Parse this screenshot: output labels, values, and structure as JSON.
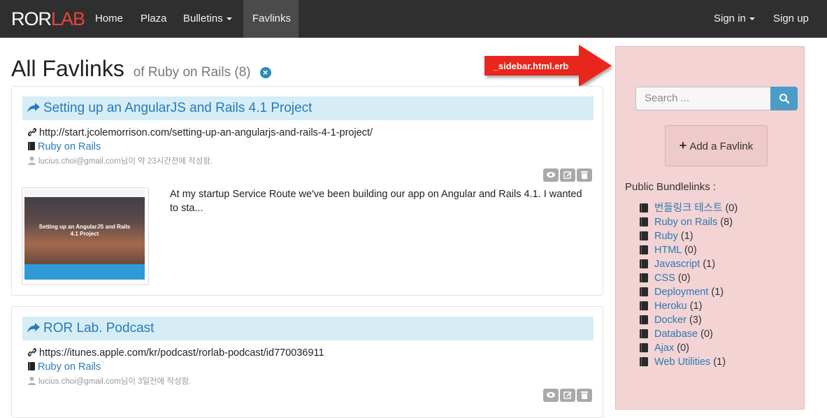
{
  "navbar": {
    "brand_a": "ROR",
    "brand_b": "LAB",
    "items": [
      {
        "label": "Home"
      },
      {
        "label": "Plaza"
      },
      {
        "label": "Bulletins"
      },
      {
        "label": "Favlinks"
      }
    ],
    "active": "Favlinks",
    "right": [
      {
        "label": "Sign in"
      },
      {
        "label": "Sign up"
      }
    ]
  },
  "page": {
    "title": "All Favlinks",
    "subtitle": "of Ruby on Rails (8)"
  },
  "annotation": {
    "label": "_sidebar.html.erb",
    "color": "#e8261b"
  },
  "cards": [
    {
      "title": "Setting up an AngularJS and Rails 4.1 Project",
      "url": "http://start.jcolemorrison.com/setting-up-an-angularjs-and-rails-4-1-project/",
      "bundle": "Ruby on Rails",
      "author": "lucius.choi@gmail.com님이 약 23시간전에 작성함.",
      "thumb_caption": "Setting up an AngularJS and Rails 4.1 Project",
      "summary": "At my startup Service Route we've been building our app on Angular and Rails 4.1. I wanted to sta..."
    },
    {
      "title": "ROR Lab. Podcast",
      "url": "https://itunes.apple.com/kr/podcast/rorlab-podcast/id770036911",
      "bundle": "Ruby on Rails",
      "author": "lucius.choi@gmail.com님이 3일전에 작성함."
    }
  ],
  "sidebar": {
    "search_placeholder": "Search ...",
    "add_label": "Add a Favlink",
    "bundlelinks_title": "Public Bundlelinks :",
    "bundlelinks": [
      {
        "name": "번들링크 테스트",
        "count": "(0)"
      },
      {
        "name": "Ruby on Rails",
        "count": "(8)"
      },
      {
        "name": "Ruby",
        "count": "(1)"
      },
      {
        "name": "HTML",
        "count": "(0)"
      },
      {
        "name": "Javascript",
        "count": "(1)"
      },
      {
        "name": "CSS",
        "count": "(0)"
      },
      {
        "name": "Deployment",
        "count": "(1)"
      },
      {
        "name": "Heroku",
        "count": "(1)"
      },
      {
        "name": "Docker",
        "count": "(3)"
      },
      {
        "name": "Database",
        "count": "(0)"
      },
      {
        "name": "Ajax",
        "count": "(0)"
      },
      {
        "name": "Web Utilities",
        "count": "(1)"
      }
    ]
  },
  "colors": {
    "navbar": "#2f2f2f",
    "link": "#2a7ab6",
    "sidebar_bg": "#f3d3d3",
    "card_title_bg": "#d6edf6"
  }
}
